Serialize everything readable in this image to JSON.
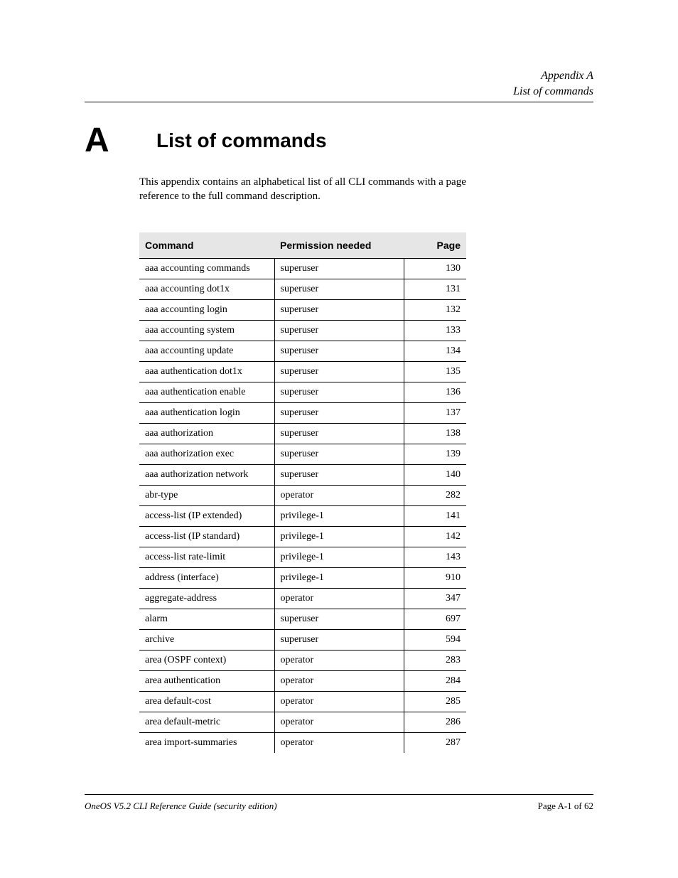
{
  "header": {
    "chapter": "Appendix A",
    "title": "List of commands"
  },
  "appendix": {
    "letter": "A",
    "title": "List of commands"
  },
  "intro": "This appendix contains an alphabetical list of all CLI commands with a page reference to the full command description.",
  "table": {
    "headers": [
      "Command",
      "Permission needed",
      "Page"
    ],
    "rows": [
      [
        "aaa accounting commands",
        "superuser",
        "130"
      ],
      [
        "aaa accounting dot1x",
        "superuser",
        "131"
      ],
      [
        "aaa accounting login",
        "superuser",
        "132"
      ],
      [
        "aaa accounting system",
        "superuser",
        "133"
      ],
      [
        "aaa accounting update",
        "superuser",
        "134"
      ],
      [
        "aaa authentication dot1x",
        "superuser",
        "135"
      ],
      [
        "aaa authentication enable",
        "superuser",
        "136"
      ],
      [
        "aaa authentication login",
        "superuser",
        "137"
      ],
      [
        "aaa authorization",
        "superuser",
        "138"
      ],
      [
        "aaa authorization exec",
        "superuser",
        "139"
      ],
      [
        "aaa authorization network",
        "superuser",
        "140"
      ],
      [
        "abr-type",
        "operator",
        "282"
      ],
      [
        "access-list (IP extended)",
        "privilege-1",
        "141"
      ],
      [
        "access-list (IP standard)",
        "privilege-1",
        "142"
      ],
      [
        "access-list rate-limit",
        "privilege-1",
        "143"
      ],
      [
        "address (interface)",
        "privilege-1",
        "910"
      ],
      [
        "aggregate-address",
        "operator",
        "347"
      ],
      [
        "alarm",
        "superuser",
        "697"
      ],
      [
        "archive",
        "superuser",
        "594"
      ],
      [
        "area (OSPF context)",
        "operator",
        "283"
      ],
      [
        "area authentication",
        "operator",
        "284"
      ],
      [
        "area default-cost",
        "operator",
        "285"
      ],
      [
        "area default-metric",
        "operator",
        "286"
      ],
      [
        "area import-summaries",
        "operator",
        "287"
      ]
    ]
  },
  "footer": {
    "left": "OneOS V5.2 CLI Reference Guide (security edition)",
    "right": "Page A-1 of 62"
  }
}
